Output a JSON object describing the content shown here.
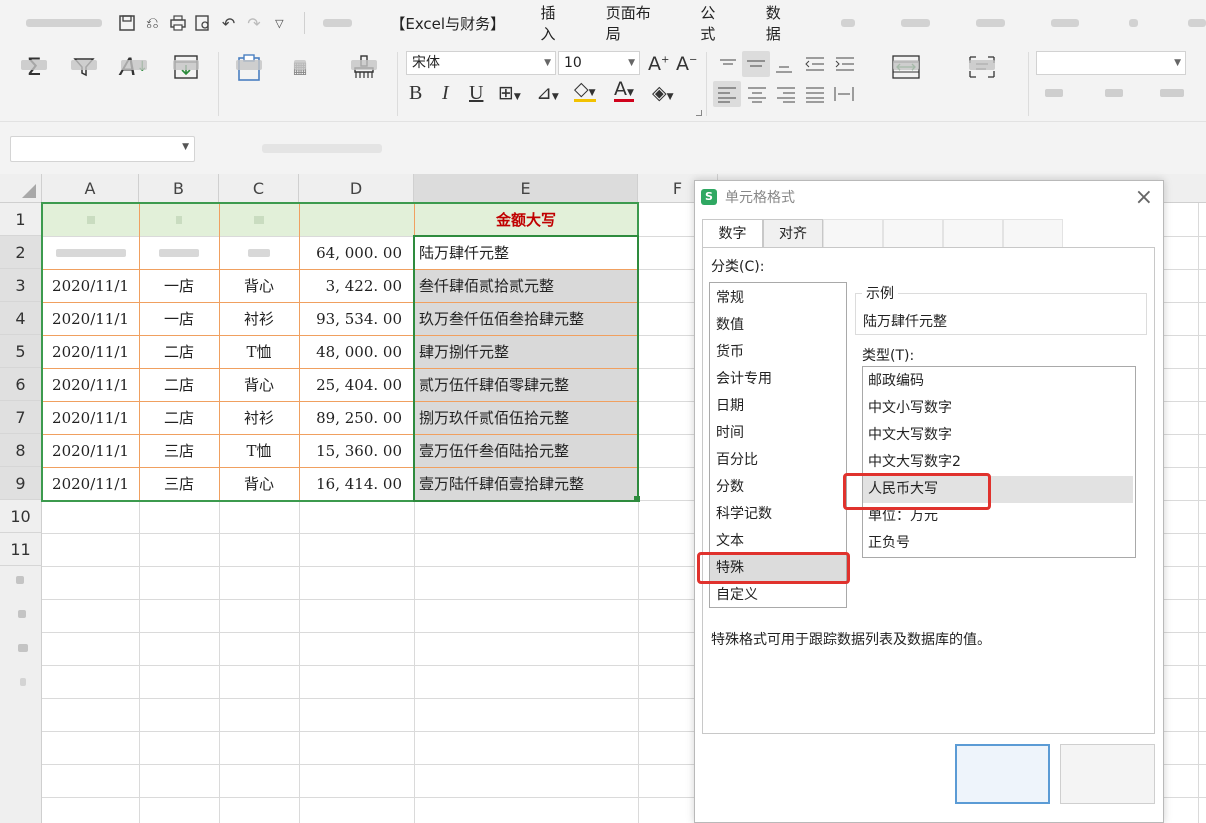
{
  "menu": {
    "title_tab": "【Excel与财务】",
    "tabs": [
      "插入",
      "页面布局",
      "公式",
      "数据"
    ]
  },
  "ribbon": {
    "font_name": "宋体",
    "font_size": "10",
    "bold": "B",
    "italic": "I",
    "underline": "U"
  },
  "sheet": {
    "columns": [
      "A",
      "B",
      "C",
      "D",
      "E",
      "F"
    ],
    "rows": [
      "1",
      "2",
      "3",
      "4",
      "5",
      "6",
      "7",
      "8",
      "9",
      "10",
      "11"
    ],
    "header_e": "金额大写",
    "row2": {
      "d": "64, 000. 00",
      "e": "陆万肆仟元整"
    },
    "data": [
      {
        "a": "2020/11/1",
        "b": "一店",
        "c": "背心",
        "d": "3, 422. 00",
        "e": "叁仟肆佰贰拾贰元整"
      },
      {
        "a": "2020/11/1",
        "b": "一店",
        "c": "衬衫",
        "d": "93, 534. 00",
        "e": "玖万叁仟伍佰叁拾肆元整"
      },
      {
        "a": "2020/11/1",
        "b": "二店",
        "c": "T恤",
        "d": "48, 000. 00",
        "e": "肆万捌仟元整"
      },
      {
        "a": "2020/11/1",
        "b": "二店",
        "c": "背心",
        "d": "25, 404. 00",
        "e": "贰万伍仟肆佰零肆元整"
      },
      {
        "a": "2020/11/1",
        "b": "二店",
        "c": "衬衫",
        "d": "89, 250. 00",
        "e": "捌万玖仟贰佰伍拾元整"
      },
      {
        "a": "2020/11/1",
        "b": "三店",
        "c": "T恤",
        "d": "15, 360. 00",
        "e": "壹万伍仟叁佰陆拾元整"
      },
      {
        "a": "2020/11/1",
        "b": "三店",
        "c": "背心",
        "d": "16, 414. 00",
        "e": "壹万陆仟肆佰壹拾肆元整"
      }
    ]
  },
  "dialog": {
    "title": "单元格格式",
    "tabs": [
      "数字",
      "对齐"
    ],
    "category_label": "分类(C):",
    "categories": [
      "常规",
      "数值",
      "货币",
      "会计专用",
      "日期",
      "时间",
      "百分比",
      "分数",
      "科学记数",
      "文本",
      "特殊",
      "自定义"
    ],
    "selected_category": "特殊",
    "sample_label": "示例",
    "sample_value": "陆万肆仟元整",
    "type_label": "类型(T):",
    "types": [
      "邮政编码",
      "中文小写数字",
      "中文大写数字",
      "中文大写数字2",
      "人民币大写",
      "单位：万元",
      "正负号"
    ],
    "selected_type": "人民币大写",
    "description": "特殊格式可用于跟踪数据列表及数据库的值。",
    "highlight_color": "#e0322d"
  }
}
